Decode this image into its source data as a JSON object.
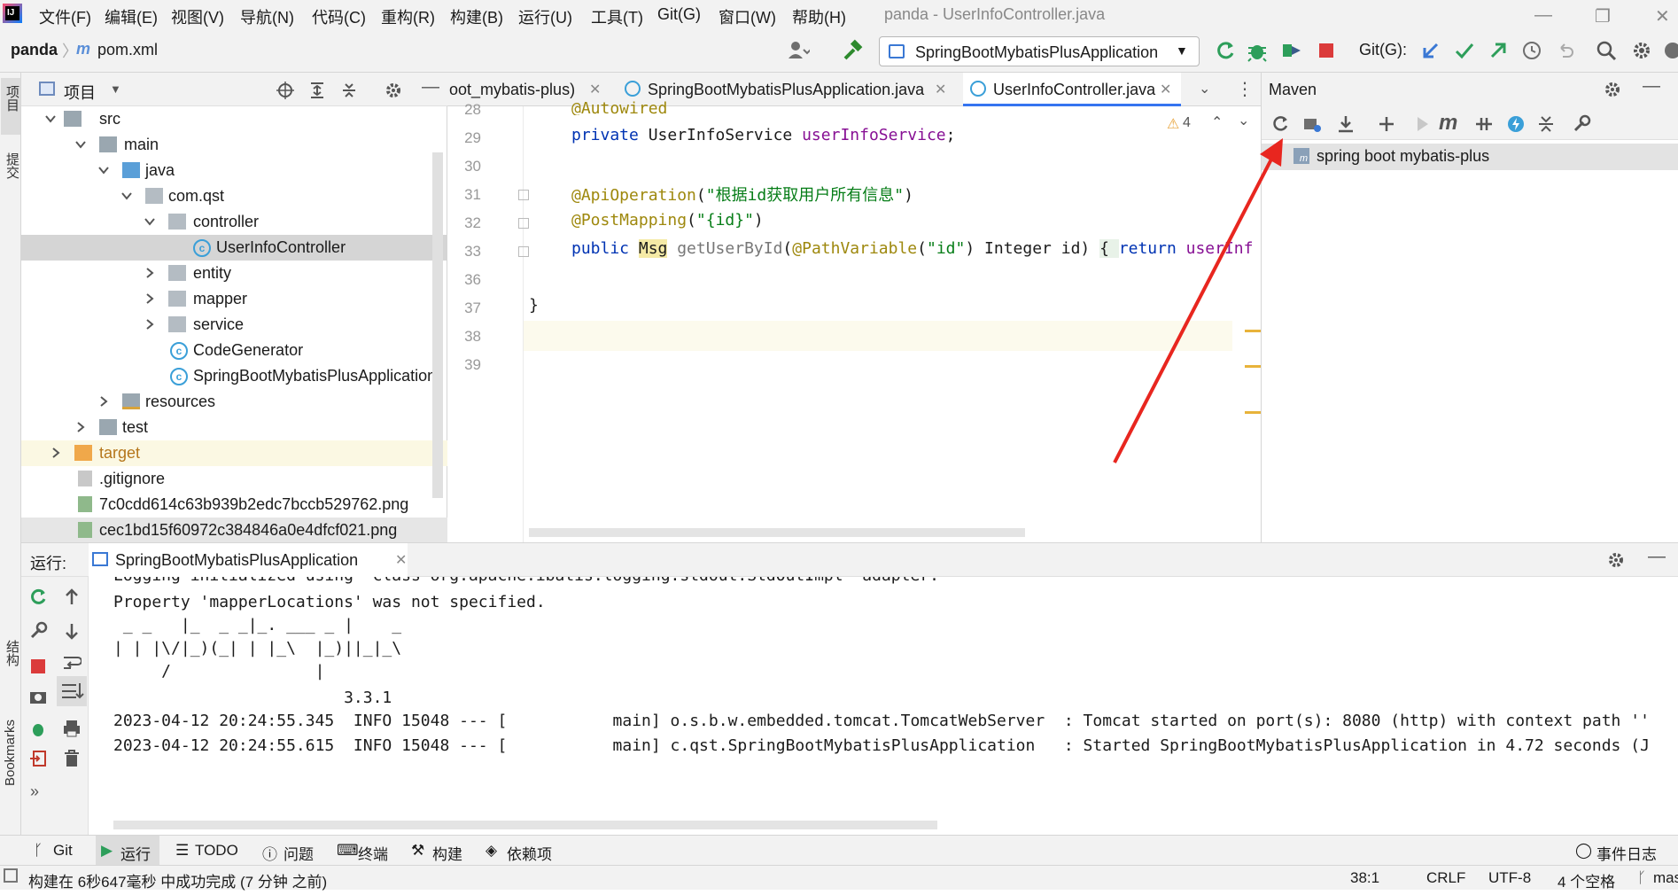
{
  "menubar": {
    "items": [
      "文件(F)",
      "编辑(E)",
      "视图(V)",
      "导航(N)",
      "代码(C)",
      "重构(R)",
      "构建(B)",
      "运行(U)",
      "工具(T)",
      "Git(G)",
      "窗口(W)",
      "帮助(H)"
    ],
    "window_title": "panda - UserInfoController.java"
  },
  "toolbar": {
    "breadcrumb_project": "panda",
    "breadcrumb_file": "pom.xml",
    "run_config": "SpringBootMybatisPlusApplication",
    "git_label": "Git(G):"
  },
  "left_stripe": {
    "project": "项目",
    "commit": "提交",
    "structure": "结构",
    "bookmarks": "Bookmarks"
  },
  "project_panel": {
    "title": "项目",
    "tree": [
      {
        "label": "src"
      },
      {
        "label": "main"
      },
      {
        "label": "java"
      },
      {
        "label": "com.qst"
      },
      {
        "label": "controller"
      },
      {
        "label": "UserInfoController"
      },
      {
        "label": "entity"
      },
      {
        "label": "mapper"
      },
      {
        "label": "service"
      },
      {
        "label": "CodeGenerator"
      },
      {
        "label": "SpringBootMybatisPlusApplication"
      },
      {
        "label": "resources"
      },
      {
        "label": "test"
      },
      {
        "label": "target"
      },
      {
        "label": ".gitignore"
      },
      {
        "label": "7c0cdd614c63b939b2edc7bccb529762.png"
      },
      {
        "label": "cec1bd15f60972c384846a0e4dfcf021.png"
      }
    ]
  },
  "editor": {
    "tabs": [
      "oot_mybatis-plus)",
      "SpringBootMybatisPlusApplication.java",
      "UserInfoController.java"
    ],
    "warnings": "4",
    "line_numbers": [
      "28",
      "29",
      "30",
      "31",
      "32",
      "33",
      "36",
      "37",
      "38",
      "39"
    ],
    "code": {
      "l28": "@Autowired",
      "l29_kw": "private ",
      "l29_type": "UserInfoService ",
      "l29_field": "userInfoService",
      "l29_end": ";",
      "l31_ann": "@ApiOperation",
      "l31_open": "(",
      "l31_str": "\"根据id获取用户所有信息\"",
      "l31_close": ")",
      "l32_ann": "@PostMapping",
      "l32_open": "(",
      "l32_str": "\"{id}\"",
      "l32_close": ")",
      "l33_kw": "public ",
      "l33_type": "Msg",
      "l33_method": " getUserById",
      "l33_p1": "(",
      "l33_ann": "@PathVariable",
      "l33_p2": "(",
      "l33_str": "\"id\"",
      "l33_p3": ") Integer id) ",
      "l33_brace": "{ ",
      "l33_ret": "return ",
      "l33_tail": "userInf",
      "l37": "}"
    }
  },
  "maven": {
    "title": "Maven",
    "project": "spring boot mybatis-plus"
  },
  "run": {
    "label": "运行:",
    "tab": "SpringBootMybatisPlusApplication",
    "lines": [
      "Logging initialized using 'class org.apache.ibatis.logging.stdout.StdOutImpl' adapter.",
      "Property 'mapperLocations' was not specified.",
      " _ _   |_  _ _|_. ___ _ |    _",
      "| | |\\/|_)(_| | |_\\  |_)||_|_\\",
      "     /               |",
      "                        3.3.1",
      "2023-04-12 20:24:55.345  INFO 15048 --- [           main] o.s.b.w.embedded.tomcat.TomcatWebServer  : Tomcat started on port(s): 8080 (http) with context path ''",
      "2023-04-12 20:24:55.615  INFO 15048 --- [           main] c.qst.SpringBootMybatisPlusApplication   : Started SpringBootMybatisPlusApplication in 4.72 seconds (J"
    ]
  },
  "bottombar": {
    "git": "Git",
    "run": "运行",
    "todo": "TODO",
    "problems": "问题",
    "terminal": "终端",
    "build": "构建",
    "deps": "依赖项",
    "events": "事件日志"
  },
  "status": {
    "message": "构建在 6秒647毫秒 中成功完成 (7 分钟 之前)",
    "position": "38:1",
    "line_sep": "CRLF",
    "encoding": "UTF-8",
    "indent": "4 个空格",
    "branch": "master"
  },
  "colors": {
    "accent": "#3574f0",
    "keyword": "#0033b3",
    "annotation": "#9e880d",
    "string": "#067d17",
    "arrow": "#e8261f"
  }
}
